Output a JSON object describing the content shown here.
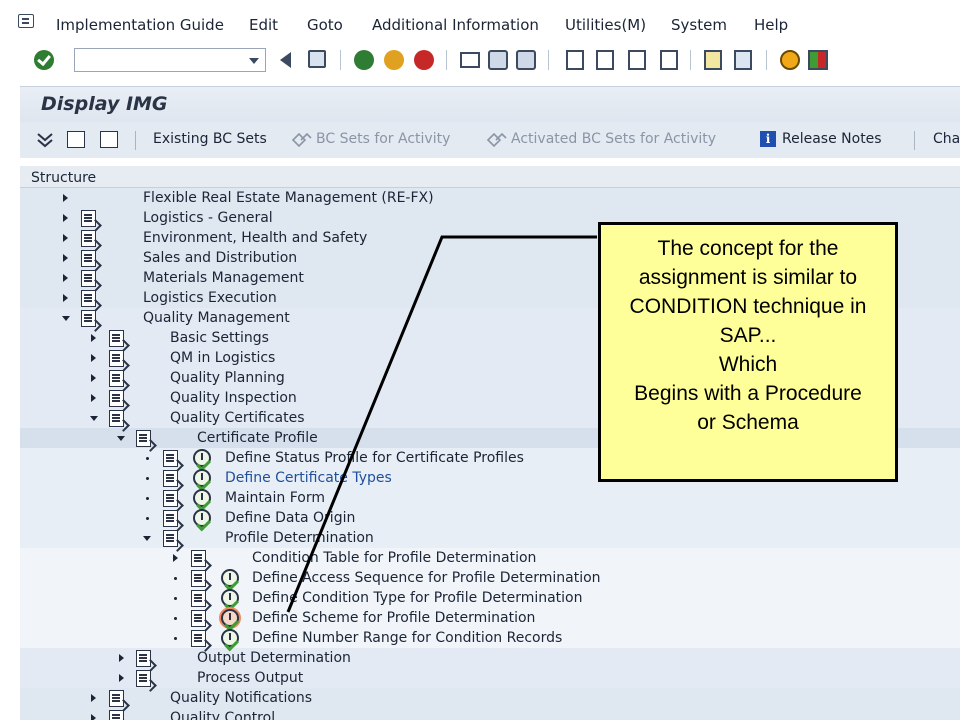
{
  "menu": {
    "items": [
      "Implementation Guide",
      "Edit",
      "Goto",
      "Additional Information",
      "Utilities(M)",
      "System",
      "Help"
    ]
  },
  "toolbar": {
    "command_field_value": "",
    "icons": [
      "enter-icon",
      "back-icon",
      "save-icon",
      "back-nav-icon",
      "exit-icon",
      "cancel-icon",
      "print-icon",
      "find-icon",
      "find-next-icon",
      "first-page-icon",
      "prev-page-icon",
      "next-page-icon",
      "last-page-icon",
      "create-session-icon",
      "shortcut-icon",
      "help-icon",
      "layout-icon"
    ]
  },
  "title": "Display IMG",
  "app_toolbar": {
    "existing_bc_sets": "Existing BC Sets",
    "bc_sets_for_activity": "BC Sets for Activity",
    "activated_bc_sets": "Activated BC Sets for Activity",
    "release_notes": "Release Notes",
    "change_log_partial": "Cha",
    "info_glyph": "i"
  },
  "tree": {
    "header": "Structure",
    "nodes": [
      {
        "label": "Flexible Real Estate Management (RE-FX)"
      },
      {
        "label": "Logistics - General"
      },
      {
        "label": "Environment, Health and Safety"
      },
      {
        "label": "Sales and Distribution"
      },
      {
        "label": "Materials Management"
      },
      {
        "label": "Logistics Execution"
      },
      {
        "label": "Quality Management"
      },
      {
        "label": "Basic Settings"
      },
      {
        "label": "QM in Logistics"
      },
      {
        "label": "Quality Planning"
      },
      {
        "label": "Quality Inspection"
      },
      {
        "label": "Quality Certificates"
      },
      {
        "label": "Certificate Profile"
      },
      {
        "label": "Define Status Profile for Certificate Profiles"
      },
      {
        "label": "Define Certificate Types"
      },
      {
        "label": "Maintain Form"
      },
      {
        "label": "Define Data Origin"
      },
      {
        "label": "Profile Determination"
      },
      {
        "label": "Condition Table for Profile Determination"
      },
      {
        "label": "Define Access Sequence for Profile Determination"
      },
      {
        "label": "Define Condition Type for Profile Determination"
      },
      {
        "label": "Define Scheme for Profile Determination"
      },
      {
        "label": "Define Number Range for Condition Records"
      },
      {
        "label": "Output Determination"
      },
      {
        "label": "Process Output"
      },
      {
        "label": "Quality Notifications"
      },
      {
        "label": "Quality Control"
      }
    ]
  },
  "callout": {
    "lines": [
      "The concept for the",
      "assignment is similar to",
      "CONDITION technique in",
      "SAP...",
      "Which",
      "Begins with a Procedure",
      "or Schema"
    ]
  },
  "colors": {
    "tree_bg": "#dfe7f1",
    "title_bg": "#e9eef5",
    "callout_bg": "#ffff99",
    "link": "#1f4f9c"
  }
}
